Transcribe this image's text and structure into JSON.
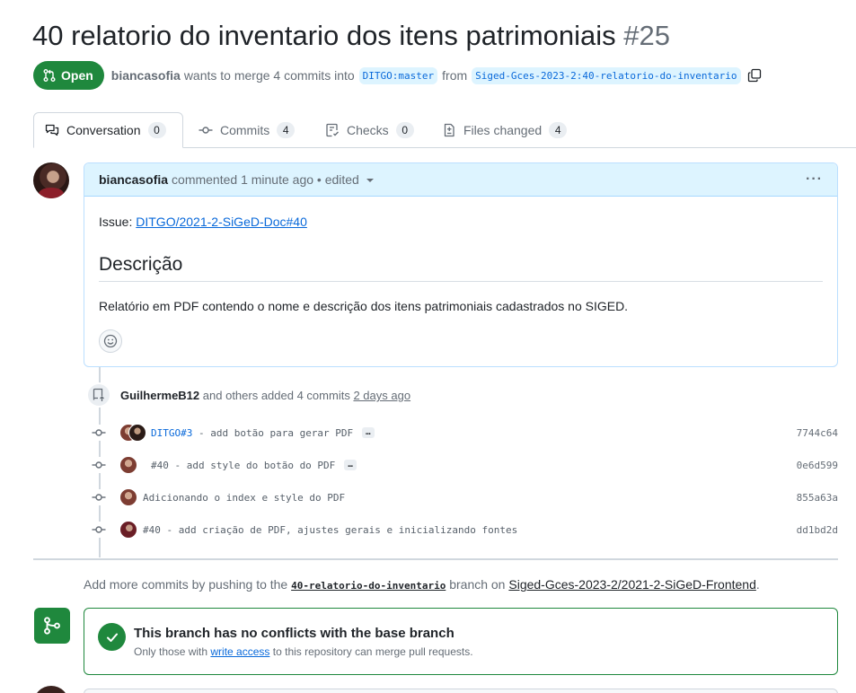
{
  "pr": {
    "title": "40 relatorio do inventario dos itens patrimoniais",
    "number": "#25",
    "state": "Open",
    "author": "biancasofia",
    "merge_text": "wants to merge 4 commits into",
    "base_branch": "DITGO:master",
    "from_text": "from",
    "head_branch": "Siged-Gces-2023-2:40-relatorio-do-inventario"
  },
  "tabs": [
    {
      "label": "Conversation",
      "count": "0"
    },
    {
      "label": "Commits",
      "count": "4"
    },
    {
      "label": "Checks",
      "count": "0"
    },
    {
      "label": "Files changed",
      "count": "4"
    }
  ],
  "comment": {
    "author": "biancasofia",
    "meta": "commented 1 minute ago • edited",
    "issue_label": "Issue:",
    "issue_link": "DITGO/2021-2-SiGeD-Doc#40",
    "heading": "Descrição",
    "body": "Relatório em PDF contendo o nome e descrição dos itens patrimoniais cadastrados no SIGED."
  },
  "event": {
    "author": "GuilhermeB12",
    "text": "and others added 4 commits",
    "time": "2 days ago"
  },
  "commits": [
    {
      "ref": "DITGO#3",
      "message": " - add botão para gerar PDF",
      "more": "…",
      "sha": "7744c64"
    },
    {
      "ref": "",
      "message": "#40 - add style do botão do PDF",
      "more": "…",
      "sha": "0e6d599"
    },
    {
      "ref": "",
      "message": "Adicionando o index e style do PDF",
      "more": "",
      "sha": "855a63a"
    },
    {
      "ref": "",
      "message": "#40 - add criação de PDF, ajustes gerais e inicializando fontes",
      "more": "",
      "sha": "dd1bd2d"
    }
  ],
  "push_note": {
    "prefix": "Add more commits by pushing to the",
    "branch": "40-relatorio-do-inventario",
    "middle": "branch on",
    "repo": "Siged-Gces-2023-2/2021-2-SiGeD-Frontend",
    "suffix": "."
  },
  "merge": {
    "title": "This branch has no conflicts with the base branch",
    "sub_prefix": "Only those with",
    "sub_link": "write access",
    "sub_suffix": "to this repository can merge pull requests."
  },
  "colors": {
    "open_green": "#1f883d",
    "link_blue": "#0969da",
    "comment_header_bg": "#ddf4ff"
  }
}
